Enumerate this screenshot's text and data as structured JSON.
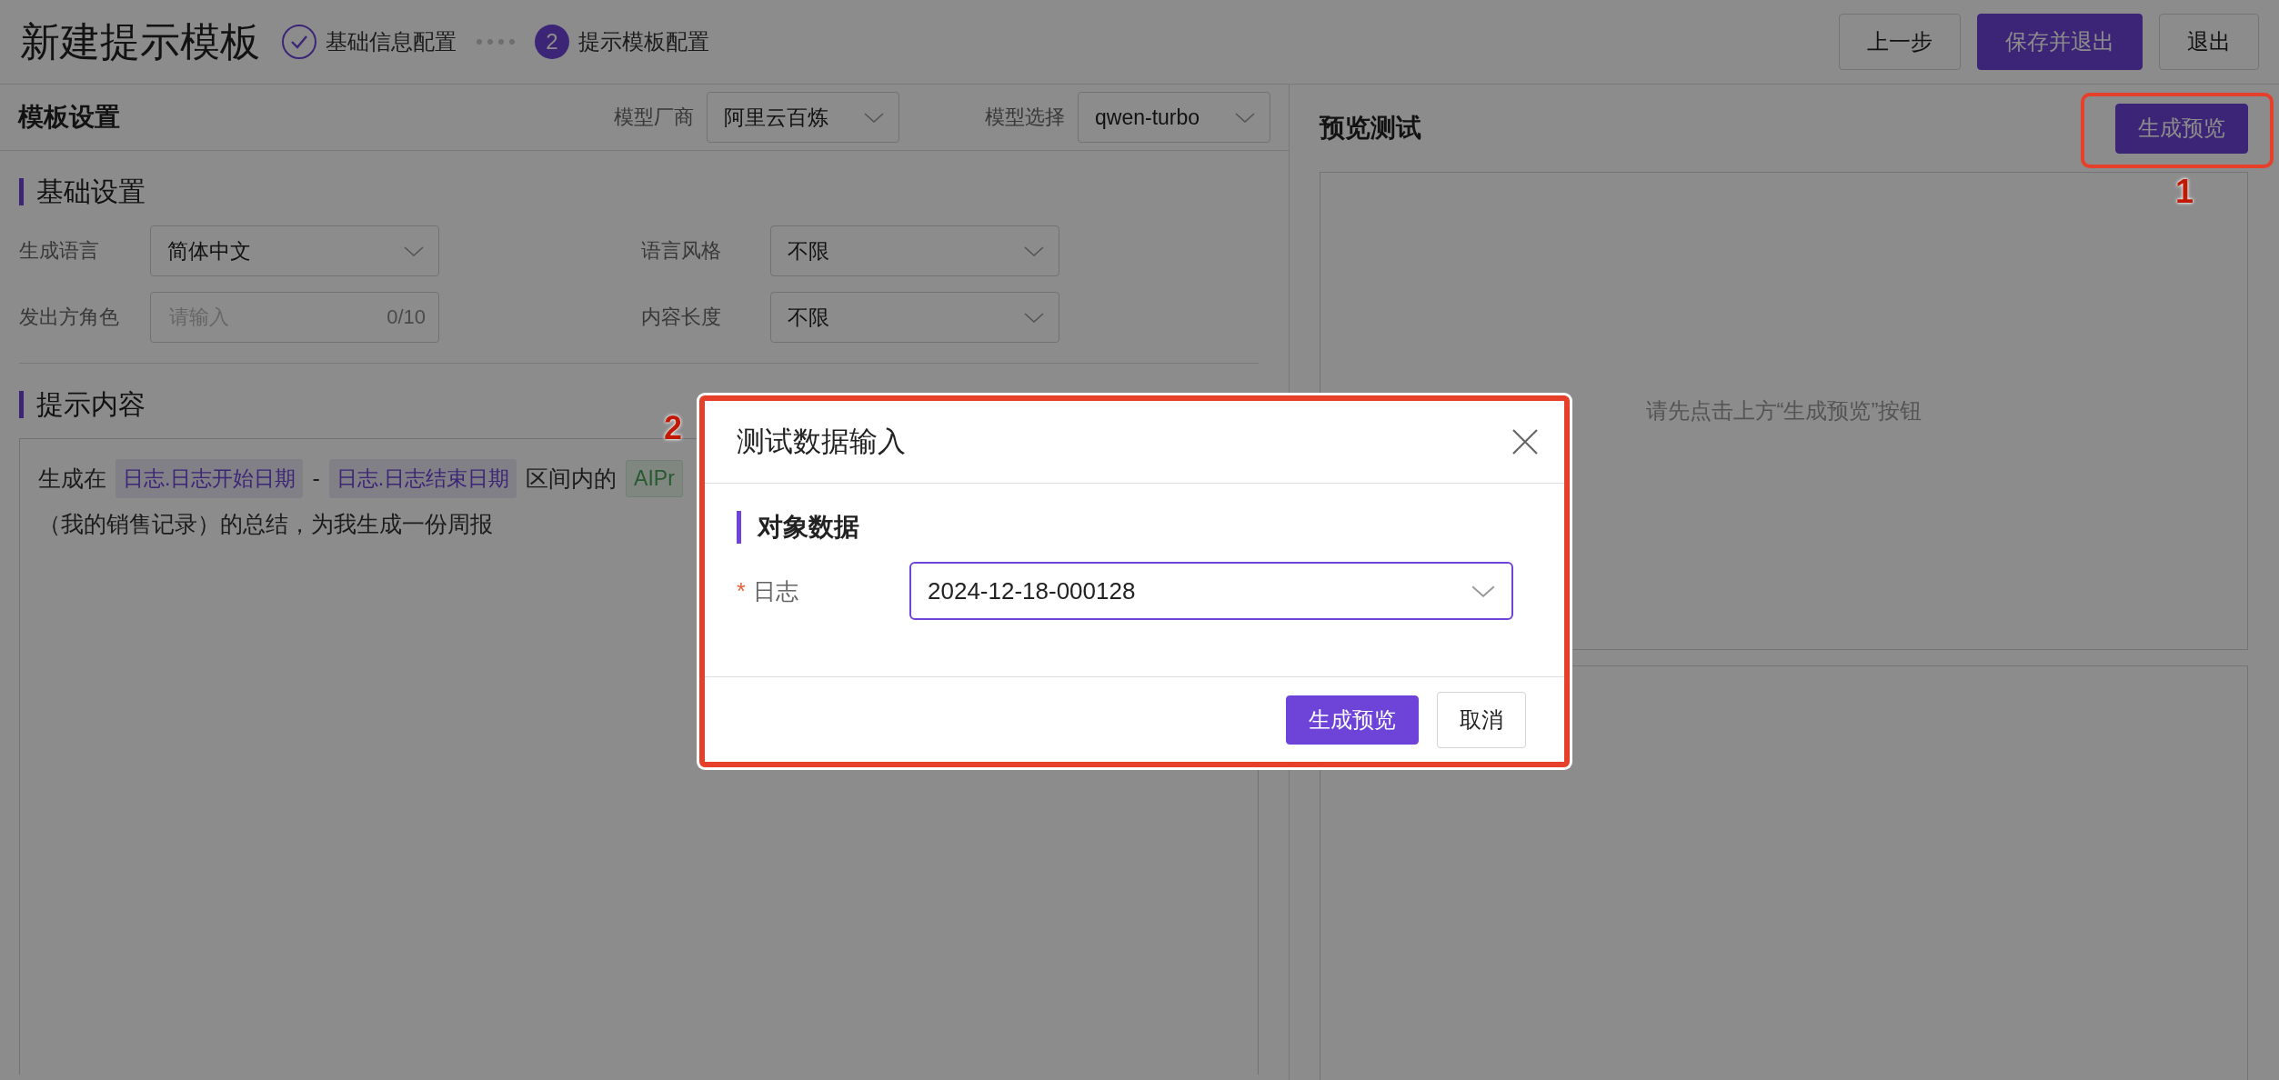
{
  "header": {
    "title": "新建提示模板",
    "steps": [
      {
        "label": "基础信息配置",
        "done": true
      },
      {
        "label": "提示模板配置",
        "done": false,
        "number": "2"
      }
    ],
    "buttons": [
      {
        "label": "上一步",
        "kind": "default"
      },
      {
        "label": "保存并退出",
        "kind": "primary"
      },
      {
        "label": "退出",
        "kind": "default"
      }
    ]
  },
  "template_settings": {
    "title": "模板设置",
    "selects": [
      {
        "label": "模型厂商",
        "value": "阿里云百炼"
      },
      {
        "label": "模型选择",
        "value": "qwen-turbo"
      }
    ]
  },
  "basic_settings": {
    "title": "基础设置",
    "fields": [
      {
        "label": "生成语言",
        "kind": "select",
        "value": "简体中文"
      },
      {
        "label": "语言风格",
        "kind": "select",
        "value": "不限"
      },
      {
        "label": "发出方角色",
        "kind": "input",
        "placeholder": "请输入",
        "counter": "0/10"
      },
      {
        "label": "内容长度",
        "kind": "select",
        "value": "不限"
      }
    ]
  },
  "prompt_content": {
    "title": "提示内容",
    "lines": [
      [
        {
          "kind": "text",
          "text": "生成在"
        },
        {
          "kind": "variable",
          "text": "日志.日志开始日期"
        },
        {
          "kind": "text",
          "text": "-"
        },
        {
          "kind": "variable",
          "text": "日志.日志结束日期"
        },
        {
          "kind": "text",
          "text": "区间内的"
        },
        {
          "kind": "object",
          "text": "AIPr"
        }
      ],
      [
        {
          "kind": "text",
          "text": "（我的销售记录）的总结，为我生成一份周报"
        }
      ]
    ]
  },
  "preview": {
    "title": "预览测试",
    "button": "生成预览",
    "placeholder": "请先点击上方“生成预览”按钮"
  },
  "dialog": {
    "title": "测试数据输入",
    "section": "对象数据",
    "field": {
      "label": "日志",
      "required_mark": "*",
      "value": "2024-12-18-000128"
    },
    "buttons": [
      {
        "label": "生成预览",
        "kind": "primary"
      },
      {
        "label": "取消",
        "kind": "default"
      }
    ]
  },
  "annotations": [
    {
      "label": "1"
    },
    {
      "label": "2"
    }
  ]
}
